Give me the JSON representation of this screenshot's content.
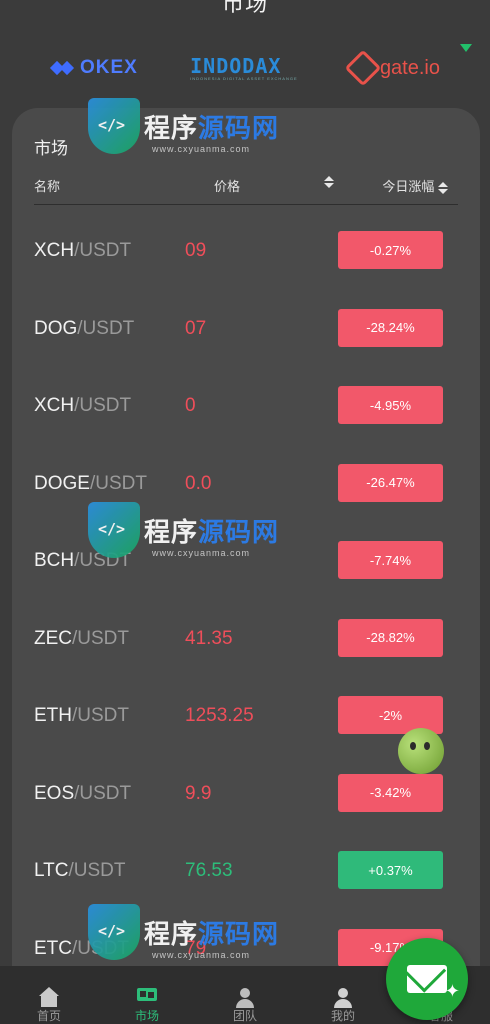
{
  "header": {
    "title": "市场"
  },
  "exchanges": [
    {
      "name": "OKEX",
      "icon": "okex-cube-icon"
    },
    {
      "name": "INDODAX",
      "tagline": "INDONESIA DIGITAL ASSET EXCHANGE",
      "icon": "indodax-logo"
    },
    {
      "name": "gate.io",
      "icon": "gate-diamond-icon"
    }
  ],
  "market": {
    "title": "市场",
    "columns": {
      "name": "名称",
      "price": "价格",
      "change": "今日涨幅"
    },
    "rows": [
      {
        "base": "XCH",
        "quote": "/USDT",
        "price": "09",
        "change": "-0.27%",
        "trend": "down"
      },
      {
        "base": "DOG",
        "quote": "/USDT",
        "price": "07",
        "change": "-28.24%",
        "trend": "down"
      },
      {
        "base": "XCH",
        "quote": "/USDT",
        "price": "0",
        "change": "-4.95%",
        "trend": "down"
      },
      {
        "base": "DOGE",
        "quote": "/USDT",
        "price": "0.0",
        "change": "-26.47%",
        "trend": "down"
      },
      {
        "base": "BCH",
        "quote": "/USDT",
        "price": "",
        "change": "-7.74%",
        "trend": "down"
      },
      {
        "base": "ZEC",
        "quote": "/USDT",
        "price": "41.35",
        "change": "-28.82%",
        "trend": "down"
      },
      {
        "base": "ETH",
        "quote": "/USDT",
        "price": "1253.25",
        "change": "-2%",
        "trend": "down"
      },
      {
        "base": "EOS",
        "quote": "/USDT",
        "price": "9.9",
        "change": "-3.42%",
        "trend": "down"
      },
      {
        "base": "LTC",
        "quote": "/USDT",
        "price": "76.53",
        "change": "+0.37%",
        "trend": "up"
      },
      {
        "base": "ETC",
        "quote": "/USDT",
        "price": "79",
        "change": "-9.17%",
        "trend": "down"
      }
    ]
  },
  "tabbar": [
    {
      "label": "首页",
      "icon": "home-icon"
    },
    {
      "label": "市场",
      "icon": "market-icon",
      "active": true
    },
    {
      "label": "团队",
      "icon": "team-icon"
    },
    {
      "label": "我的",
      "icon": "user-icon"
    },
    {
      "label": "客服",
      "icon": "mail-icon"
    }
  ],
  "watermark": {
    "brand_a": "程序",
    "brand_b": "源码网",
    "url": "www.cxyuanma.com"
  },
  "colors": {
    "down": "#f2586a",
    "up": "#2fba7a",
    "background": "#3b3b3b",
    "card": "#4a4a4a"
  }
}
